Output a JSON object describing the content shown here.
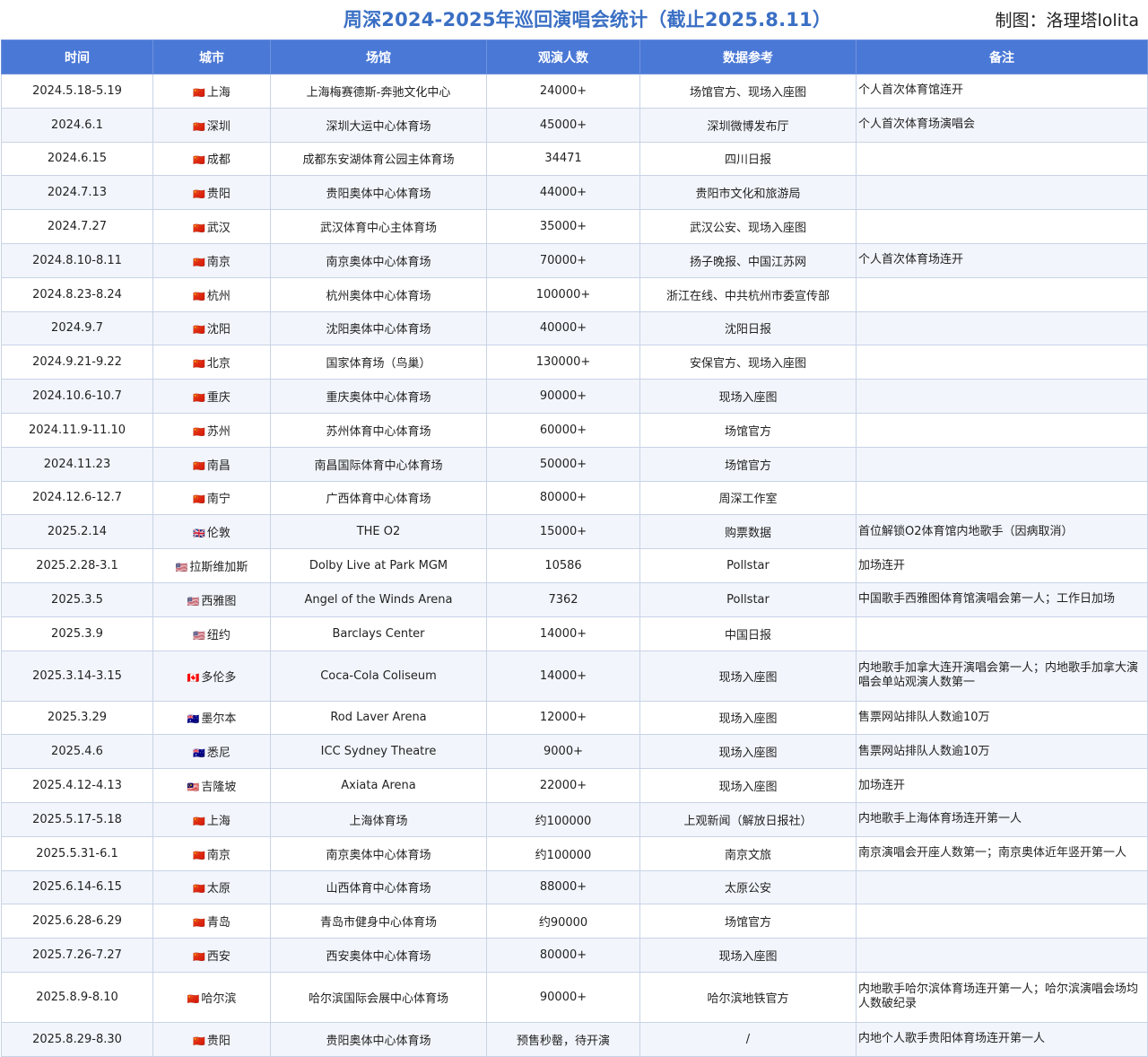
{
  "header": {
    "title": "周深2024-2025年巡回演唱会统计（截止2025.8.11）",
    "credit": "制图：洛理塔lolita"
  },
  "columns": [
    "时间",
    "城市",
    "场馆",
    "观演人数",
    "数据参考",
    "备注"
  ],
  "rows": [
    {
      "date": "2024.5.18-5.19",
      "flag": "🇨🇳",
      "city": "上海",
      "venue": "上海梅赛德斯-奔驰文化中心",
      "audience": "24000+",
      "source": "场馆官方、现场入座图",
      "note": "个人首次体育馆连开"
    },
    {
      "date": "2024.6.1",
      "flag": "🇨🇳",
      "city": "深圳",
      "venue": "深圳大运中心体育场",
      "audience": "45000+",
      "source": "深圳微博发布厅",
      "note": "个人首次体育场演唱会"
    },
    {
      "date": "2024.6.15",
      "flag": "🇨🇳",
      "city": "成都",
      "venue": "成都东安湖体育公园主体育场",
      "audience": "34471",
      "source": "四川日报",
      "note": ""
    },
    {
      "date": "2024.7.13",
      "flag": "🇨🇳",
      "city": "贵阳",
      "venue": "贵阳奥体中心体育场",
      "audience": "44000+",
      "source": "贵阳市文化和旅游局",
      "note": ""
    },
    {
      "date": "2024.7.27",
      "flag": "🇨🇳",
      "city": "武汉",
      "venue": "武汉体育中心主体育场",
      "audience": "35000+",
      "source": "武汉公安、现场入座图",
      "note": ""
    },
    {
      "date": "2024.8.10-8.11",
      "flag": "🇨🇳",
      "city": "南京",
      "venue": "南京奥体中心体育场",
      "audience": "70000+",
      "source": "扬子晚报、中国江苏网",
      "note": "个人首次体育场连开"
    },
    {
      "date": "2024.8.23-8.24",
      "flag": "🇨🇳",
      "city": "杭州",
      "venue": "杭州奥体中心体育场",
      "audience": "100000+",
      "source": "浙江在线、中共杭州市委宣传部",
      "note": ""
    },
    {
      "date": "2024.9.7",
      "flag": "🇨🇳",
      "city": "沈阳",
      "venue": "沈阳奥体中心体育场",
      "audience": "40000+",
      "source": "沈阳日报",
      "note": ""
    },
    {
      "date": "2024.9.21-9.22",
      "flag": "🇨🇳",
      "city": "北京",
      "venue": "国家体育场（鸟巢）",
      "audience": "130000+",
      "source": "安保官方、现场入座图",
      "note": ""
    },
    {
      "date": "2024.10.6-10.7",
      "flag": "🇨🇳",
      "city": "重庆",
      "venue": "重庆奥体中心体育场",
      "audience": "90000+",
      "source": "现场入座图",
      "note": ""
    },
    {
      "date": "2024.11.9-11.10",
      "flag": "🇨🇳",
      "city": "苏州",
      "venue": "苏州体育中心体育场",
      "audience": "60000+",
      "source": "场馆官方",
      "note": ""
    },
    {
      "date": "2024.11.23",
      "flag": "🇨🇳",
      "city": "南昌",
      "venue": "南昌国际体育中心体育场",
      "audience": "50000+",
      "source": "场馆官方",
      "note": ""
    },
    {
      "date": "2024.12.6-12.7",
      "flag": "🇨🇳",
      "city": "南宁",
      "venue": "广西体育中心体育场",
      "audience": "80000+",
      "source": "周深工作室",
      "note": ""
    },
    {
      "date": "2025.2.14",
      "flag": "🇬🇧",
      "city": "伦敦",
      "venue": "THE O2",
      "audience": "15000+",
      "source": "购票数据",
      "note": "首位解锁O2体育馆内地歌手（因病取消）"
    },
    {
      "date": "2025.2.28-3.1",
      "flag": "🇺🇸",
      "city": "拉斯维加斯",
      "venue": "Dolby Live at Park MGM",
      "audience": "10586",
      "source": "Pollstar",
      "note": "加场连开"
    },
    {
      "date": "2025.3.5",
      "flag": "🇺🇸",
      "city": "西雅图",
      "venue": "Angel of the Winds Arena",
      "audience": "7362",
      "source": "Pollstar",
      "note": "中国歌手西雅图体育馆演唱会第一人；工作日加场"
    },
    {
      "date": "2025.3.9",
      "flag": "🇺🇸",
      "city": "纽约",
      "venue": "Barclays Center",
      "audience": "14000+",
      "source": "中国日报",
      "note": ""
    },
    {
      "date": "2025.3.14-3.15",
      "flag": "🇨🇦",
      "city": "多伦多",
      "venue": "Coca-Cola Coliseum",
      "audience": "14000+",
      "source": "现场入座图",
      "note": "内地歌手加拿大连开演唱会第一人；内地歌手加拿大演唱会单站观演人数第一"
    },
    {
      "date": "2025.3.29",
      "flag": "🇦🇺",
      "city": "墨尔本",
      "venue": "Rod Laver Arena",
      "audience": "12000+",
      "source": "现场入座图",
      "note": "售票网站排队人数逾10万"
    },
    {
      "date": "2025.4.6",
      "flag": "🇦🇺",
      "city": "悉尼",
      "venue": "ICC Sydney Theatre",
      "audience": "9000+",
      "source": "现场入座图",
      "note": "售票网站排队人数逾10万"
    },
    {
      "date": "2025.4.12-4.13",
      "flag": "🇲🇾",
      "city": "吉隆坡",
      "venue": "Axiata Arena",
      "audience": "22000+",
      "source": "现场入座图",
      "note": "加场连开"
    },
    {
      "date": "2025.5.17-5.18",
      "flag": "🇨🇳",
      "city": "上海",
      "venue": "上海体育场",
      "audience": "约100000",
      "source": "上观新闻（解放日报社）",
      "note": "内地歌手上海体育场连开第一人"
    },
    {
      "date": "2025.5.31-6.1",
      "flag": "🇨🇳",
      "city": "南京",
      "venue": "南京奥体中心体育场",
      "audience": "约100000",
      "source": "南京文旅",
      "note": "南京演唱会开座人数第一；南京奥体近年竖开第一人"
    },
    {
      "date": "2025.6.14-6.15",
      "flag": "🇨🇳",
      "city": "太原",
      "venue": "山西体育中心体育场",
      "audience": "88000+",
      "source": "太原公安",
      "note": ""
    },
    {
      "date": "2025.6.28-6.29",
      "flag": "🇨🇳",
      "city": "青岛",
      "venue": "青岛市健身中心体育场",
      "audience": "约90000",
      "source": "场馆官方",
      "note": ""
    },
    {
      "date": "2025.7.26-7.27",
      "flag": "🇨🇳",
      "city": "西安",
      "venue": "西安奥体中心体育场",
      "audience": "80000+",
      "source": "现场入座图",
      "note": ""
    },
    {
      "date": "2025.8.9-8.10",
      "flag": "🇨🇳",
      "city": "哈尔滨",
      "venue": "哈尔滨国际会展中心体育场",
      "audience": "90000+",
      "source": "哈尔滨地铁官方",
      "note": "内地歌手哈尔滨体育场连开第一人；哈尔滨演唱会场均人数破纪录"
    },
    {
      "date": "2025.8.29-8.30",
      "flag": "🇨🇳",
      "city": "贵阳",
      "venue": "贵阳奥体中心体育场",
      "audience": "预售秒罄，待开演",
      "source": "/",
      "note": "内地个人歌手贵阳体育场连开第一人"
    }
  ]
}
